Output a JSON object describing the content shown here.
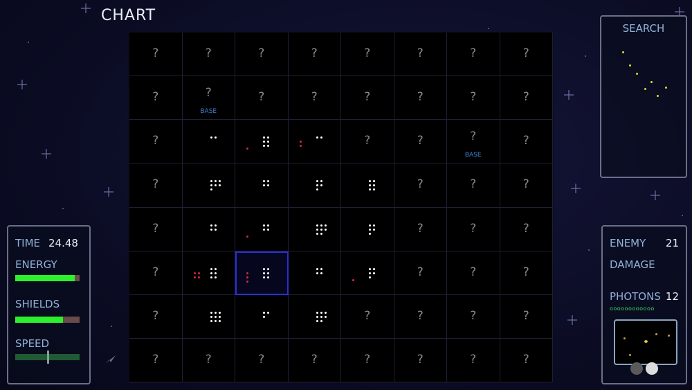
{
  "title": "CHART",
  "grid": {
    "rows": [
      [
        {
          "t": "?"
        },
        {
          "t": "?"
        },
        {
          "t": "?"
        },
        {
          "t": "?"
        },
        {
          "t": "?"
        },
        {
          "t": "?"
        },
        {
          "t": "?"
        },
        {
          "t": "?"
        }
      ],
      [
        {
          "t": "?"
        },
        {
          "t": "?",
          "base": "BASE"
        },
        {
          "t": "?"
        },
        {
          "t": "?"
        },
        {
          "t": "?"
        },
        {
          "t": "?"
        },
        {
          "t": "?"
        },
        {
          "t": "?"
        }
      ],
      [
        {
          "t": "?"
        },
        {
          "w": 2
        },
        {
          "w": 6,
          "r": 1
        },
        {
          "w": 2,
          "r": 2
        },
        {
          "t": "?"
        },
        {
          "t": "?"
        },
        {
          "t": "?",
          "base": "BASE"
        },
        {
          "t": "?"
        }
      ],
      [
        {
          "t": "?"
        },
        {
          "w": 7
        },
        {
          "w": 4
        },
        {
          "w": 5
        },
        {
          "w": 6
        },
        {
          "t": "?"
        },
        {
          "t": "?"
        },
        {
          "t": "?"
        }
      ],
      [
        {
          "t": "?"
        },
        {
          "w": 4
        },
        {
          "w": 4,
          "r": 1
        },
        {
          "w": 8
        },
        {
          "w": 5
        },
        {
          "t": "?"
        },
        {
          "t": "?"
        },
        {
          "t": "?"
        }
      ],
      [
        {
          "t": "?"
        },
        {
          "w": 6,
          "r": 4
        },
        {
          "w": 6,
          "r": 3,
          "selected": true
        },
        {
          "w": 4
        },
        {
          "w": 5,
          "r": 1
        },
        {
          "t": "?"
        },
        {
          "t": "?"
        },
        {
          "t": "?"
        }
      ],
      [
        {
          "t": "?"
        },
        {
          "w": 9
        },
        {
          "w": 3
        },
        {
          "w": 8
        },
        {
          "t": "?"
        },
        {
          "t": "?"
        },
        {
          "t": "?"
        },
        {
          "t": "?"
        }
      ],
      [
        {
          "t": "?"
        },
        {
          "t": "?"
        },
        {
          "t": "?"
        },
        {
          "t": "?"
        },
        {
          "t": "?"
        },
        {
          "t": "?"
        },
        {
          "t": "?"
        },
        {
          "t": "?"
        }
      ]
    ]
  },
  "left_panel": {
    "time_label": "TIME",
    "time_value": "24.48",
    "energy_label": "ENERGY",
    "energy_level": 0.92,
    "shields_label": "SHIELDS",
    "shields_level": 0.74,
    "speed_label": "SPEED",
    "speed_level": 0.5
  },
  "search_panel": {
    "title": "SEARCH"
  },
  "right_panel": {
    "enemy_label": "ENEMY",
    "enemy_value": "21",
    "damage_label": "DAMAGE",
    "photons_label": "PHOTONS",
    "photons_value": "12",
    "photon_indicator": "oooooooooooo"
  },
  "colors": {
    "accent_blue": "#3f83d6",
    "bar_green": "#2cf02c",
    "enemy_red": "#d62a3a",
    "selection": "#2a2fd6"
  },
  "icons": [
    "cursor-arrow-icon",
    "orb-icon"
  ]
}
